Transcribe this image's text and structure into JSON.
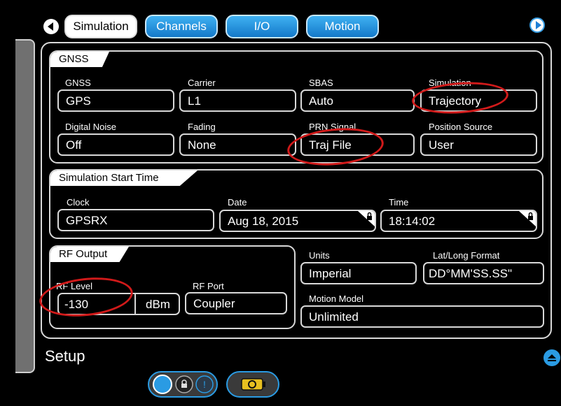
{
  "nav": {
    "tabs": [
      "Simulation",
      "Channels",
      "I/O",
      "Motion"
    ],
    "active_tab": "Simulation"
  },
  "gnss": {
    "title": "GNSS",
    "fields": [
      {
        "label": "GNSS",
        "value": "GPS"
      },
      {
        "label": "Carrier",
        "value": "L1"
      },
      {
        "label": "SBAS",
        "value": "Auto"
      },
      {
        "label": "Simulation",
        "value": "Trajectory"
      },
      {
        "label": "Digital Noise",
        "value": "Off"
      },
      {
        "label": "Fading",
        "value": "None"
      },
      {
        "label": "PRN Signal",
        "value": "Traj File"
      },
      {
        "label": "Position Source",
        "value": "User"
      }
    ]
  },
  "start_time": {
    "title": "Simulation Start Time",
    "clock_label": "Clock",
    "clock_value": "GPSRX",
    "date_label": "Date",
    "date_value": "Aug 18, 2015",
    "time_label": "Time",
    "time_value": "18:14:02"
  },
  "rf_output": {
    "title": "RF Output",
    "rf_level_label": "RF Level",
    "rf_level_value": "-130",
    "rf_level_unit": "dBm",
    "rf_port_label": "RF Port",
    "rf_port_value": "Coupler"
  },
  "settings": {
    "units_label": "Units",
    "units_value": "Imperial",
    "latlong_label": "Lat/Long Format",
    "latlong_value": "DD°MM'SS.SS\"",
    "motion_label": "Motion Model",
    "motion_value": "Unlimited"
  },
  "footer": {
    "setup_label": "Setup"
  },
  "colors": {
    "accent_blue": "#2a9be3",
    "highlight_red": "#d11a1a",
    "border_gray": "#d8d8d8",
    "drawer_gray": "#707070"
  },
  "icons": [
    "back-arrow-icon",
    "forward-arrow-icon",
    "lock-icon",
    "scroll-up-icon",
    "lock-toggle-icon",
    "battery-icon"
  ]
}
